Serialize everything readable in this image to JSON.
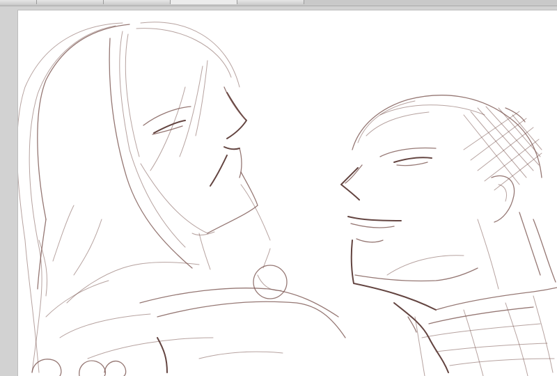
{
  "app": {
    "stroke_color": "#7a5550",
    "canvas_color": "#ffffff",
    "workspace_color": "#d2d2d2"
  },
  "tabs": [
    {
      "label": ""
    },
    {
      "label": ""
    },
    {
      "label": ""
    },
    {
      "label": ""
    }
  ],
  "canvas": {
    "content": "sketch-artwork"
  }
}
